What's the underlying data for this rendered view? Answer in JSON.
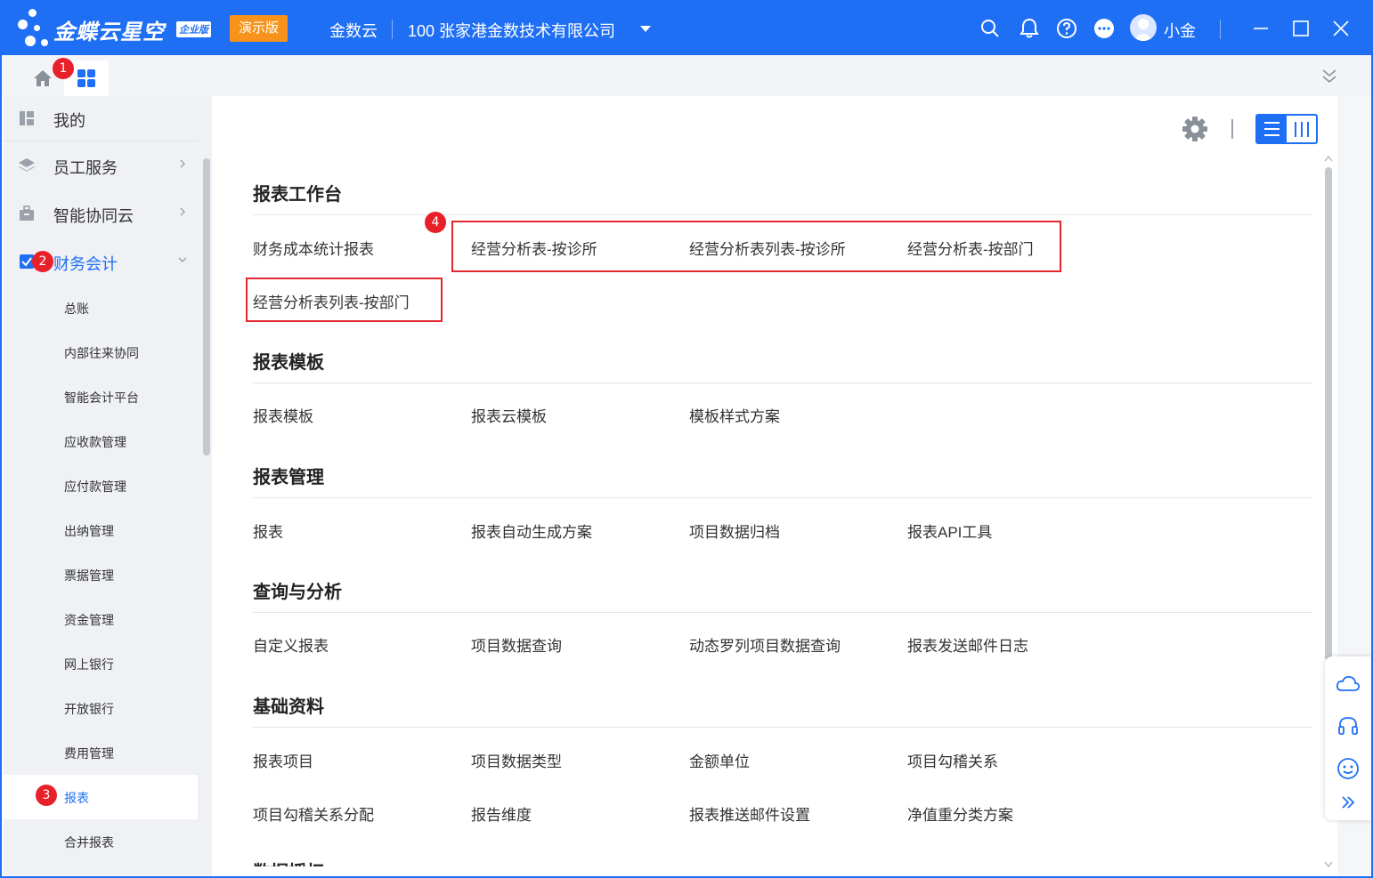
{
  "app": {
    "brand": "金蝶云星空",
    "edition_badge": "企业版",
    "demo_badge": "演示版",
    "tenant": "金数云",
    "org": "100  张家港金数技术有限公司",
    "username": "小金"
  },
  "markers": [
    "1",
    "2",
    "3",
    "4"
  ],
  "sidebar": {
    "top_items": [
      {
        "label": "我的",
        "icon": "dashboard-icon"
      },
      {
        "label": "员工服务",
        "icon": "layers-icon"
      },
      {
        "label": "智能协同云",
        "icon": "briefcase-icon"
      },
      {
        "label": "财务会计",
        "icon": "checkbox-icon"
      }
    ],
    "sub_items": [
      "总账",
      "内部往来协同",
      "智能会计平台",
      "应收款管理",
      "应付款管理",
      "出纳管理",
      "票据管理",
      "资金管理",
      "网上银行",
      "开放银行",
      "费用管理",
      "报表",
      "合并报表"
    ]
  },
  "sections": [
    {
      "title": "报表工作台",
      "links": [
        "财务成本统计报表",
        "经营分析表-按诊所",
        "经营分析表列表-按诊所",
        "经营分析表-按部门",
        "经营分析表列表-按部门"
      ]
    },
    {
      "title": "报表模板",
      "links": [
        "报表模板",
        "报表云模板",
        "模板样式方案"
      ]
    },
    {
      "title": "报表管理",
      "links": [
        "报表",
        "报表自动生成方案",
        "项目数据归档",
        "报表API工具"
      ]
    },
    {
      "title": "查询与分析",
      "links": [
        "自定义报表",
        "项目数据查询",
        "动态罗列项目数据查询",
        "报表发送邮件日志"
      ]
    },
    {
      "title": "基础资料",
      "links": [
        "报表项目",
        "项目数据类型",
        "金额单位",
        "项目勾稽关系",
        "项目勾稽关系分配",
        "报告维度",
        "报表推送邮件设置",
        "净值重分类方案"
      ]
    },
    {
      "title": "数据授权",
      "links": []
    }
  ],
  "colors": {
    "primary": "#1f6ff5",
    "demo": "#f7931a",
    "marker": "#e8202a",
    "highlight_box": "#e3262e"
  }
}
